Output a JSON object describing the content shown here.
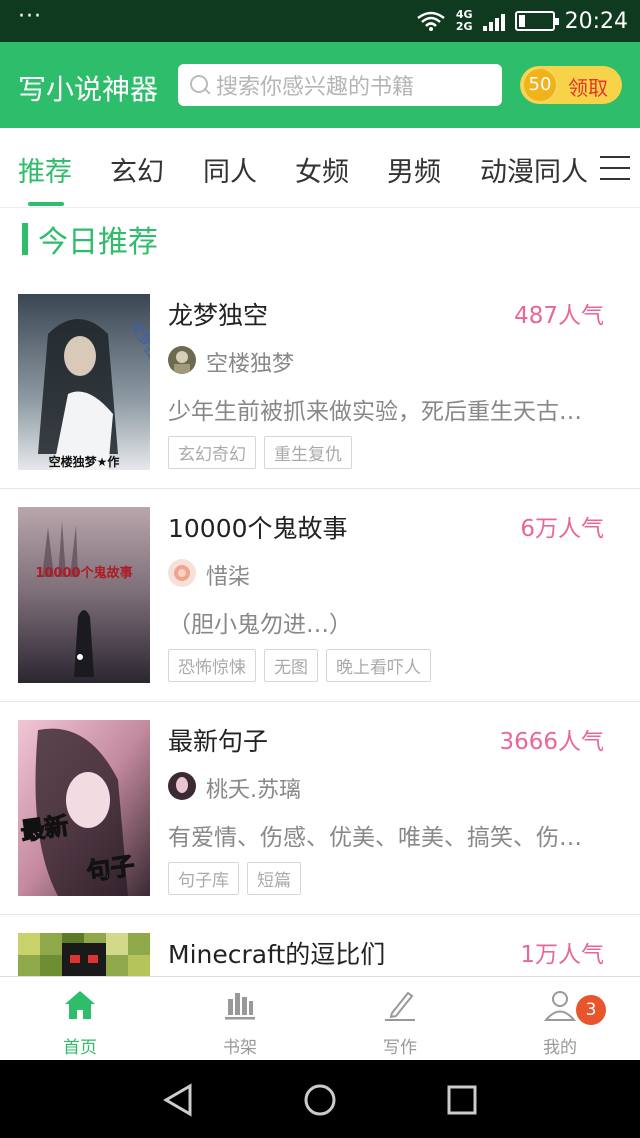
{
  "status_bar": {
    "network_top": "4G",
    "network_bottom": "2G",
    "battery_level": 0.2,
    "time": "20:24"
  },
  "header": {
    "title": "写小说神器",
    "search_placeholder": "搜索你感兴趣的书籍",
    "coin_value": "50",
    "claim_label": "领取"
  },
  "tabs": [
    {
      "label": "推荐",
      "active": true
    },
    {
      "label": "玄幻"
    },
    {
      "label": "同人"
    },
    {
      "label": "女频"
    },
    {
      "label": "男频"
    },
    {
      "label": "动漫同人"
    }
  ],
  "section": {
    "title": "今日推荐"
  },
  "books": [
    {
      "title": "龙梦独空",
      "popularity": "487人气",
      "author": "空楼独梦",
      "description": "少年生前被抓来做实验，死后重生天古…",
      "tags": [
        "玄幻奇幻",
        "重生复仇"
      ],
      "cover_text": "空楼独梦★作"
    },
    {
      "title": "10000个鬼故事",
      "popularity": "6万人气",
      "author": "惜柒",
      "description": "（胆小鬼勿进…）",
      "tags": [
        "恐怖惊悚",
        "无图",
        "晚上看吓人"
      ],
      "cover_text": "10000个鬼故事"
    },
    {
      "title": "最新句子",
      "popularity": "3666人气",
      "author": "桃夭.苏璃",
      "description": "有爱情、伤感、优美、唯美、搞笑、伤…",
      "tags": [
        "句子库",
        "短篇"
      ],
      "cover_text": "最新句子"
    },
    {
      "title": "Minecraft的逗比们",
      "popularity": "1万人气"
    }
  ],
  "bottom_nav": [
    {
      "label": "首页",
      "icon": "home-icon",
      "active": true
    },
    {
      "label": "书架",
      "icon": "bookshelf-icon"
    },
    {
      "label": "写作",
      "icon": "pen-icon"
    },
    {
      "label": "我的",
      "icon": "user-icon",
      "badge": "3"
    }
  ],
  "colors": {
    "primary": "#2ebd6b",
    "popularity": "#e9669a",
    "badge": "#e8542c",
    "status_bar": "#0f3a1f"
  }
}
